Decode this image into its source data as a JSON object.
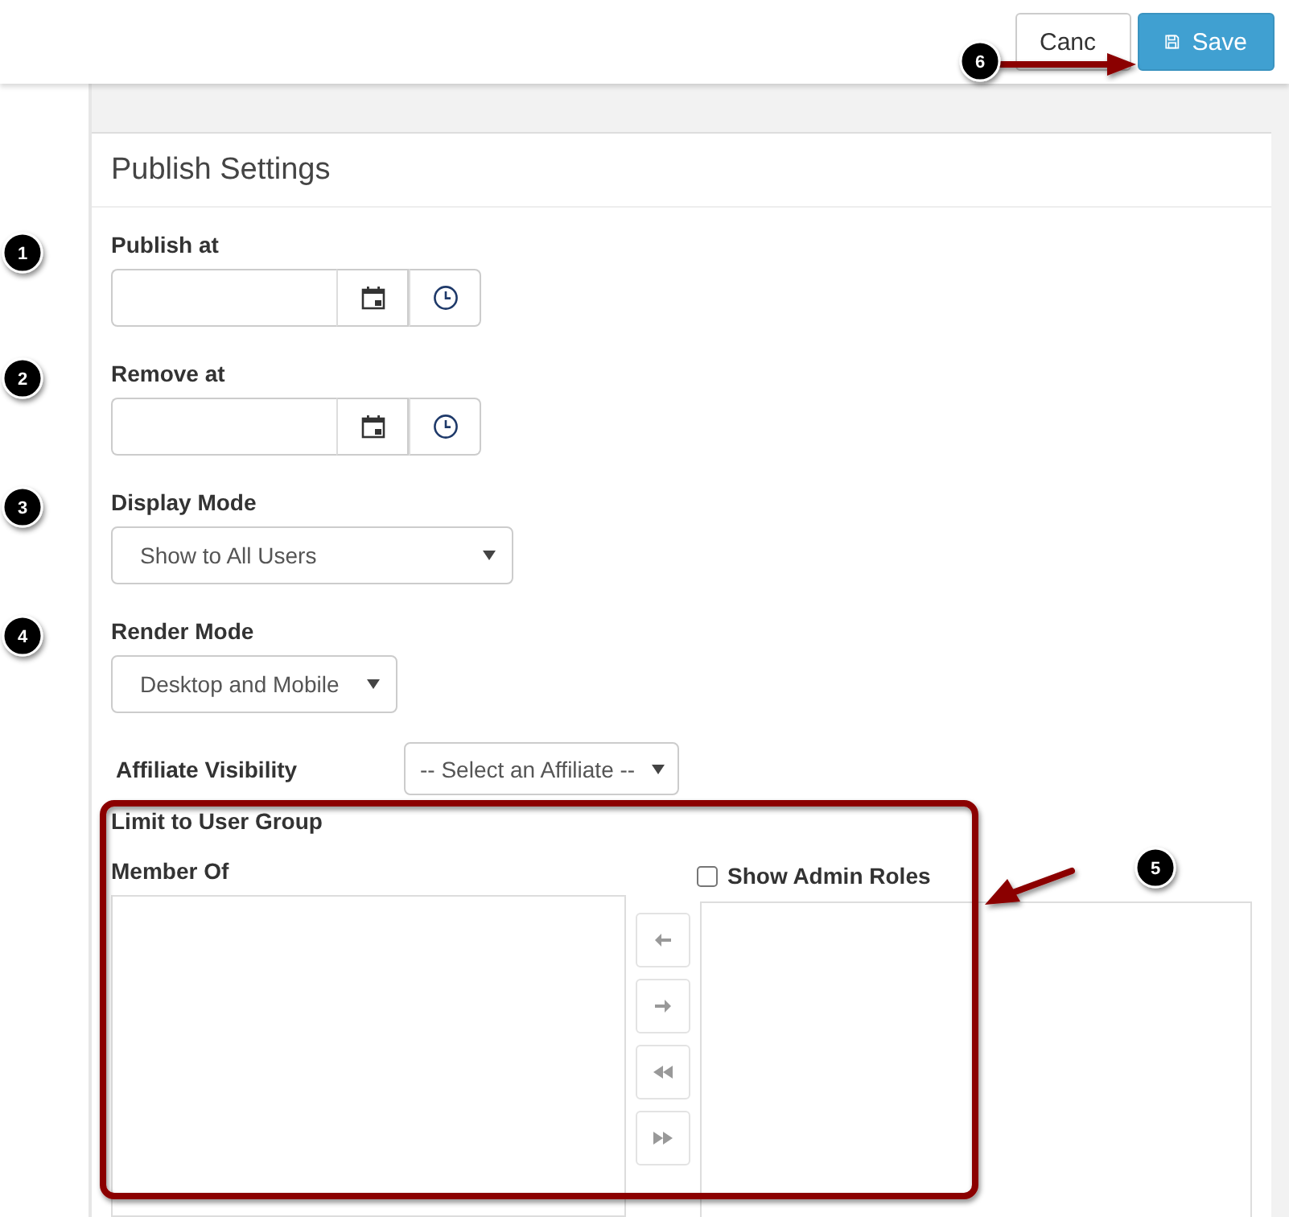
{
  "toolbar": {
    "buttons": [
      {
        "kind": "cancel",
        "label": "Canc"
      },
      {
        "kind": "save",
        "label": "Save"
      }
    ]
  },
  "panel": {
    "title": "Publish Settings",
    "fields": [
      {
        "kind": "datetime",
        "label": "Publish at"
      },
      {
        "kind": "datetime",
        "label": "Remove at"
      },
      {
        "kind": "select",
        "label": "Display Mode",
        "value": "Show to All Users"
      },
      {
        "kind": "select",
        "label": "Render Mode",
        "value": "Desktop and Mobile"
      },
      {
        "kind": "inline-select",
        "label": "Affiliate Visibility",
        "value": "-- Select an Affiliate --"
      }
    ]
  },
  "user_group": {
    "title": "Limit to User Group",
    "member_label": "Member Of",
    "show_admin_roles": {
      "label": "Show Admin Roles",
      "checked": false
    }
  },
  "callouts": [
    "1",
    "2",
    "3",
    "4",
    "5",
    "6"
  ]
}
